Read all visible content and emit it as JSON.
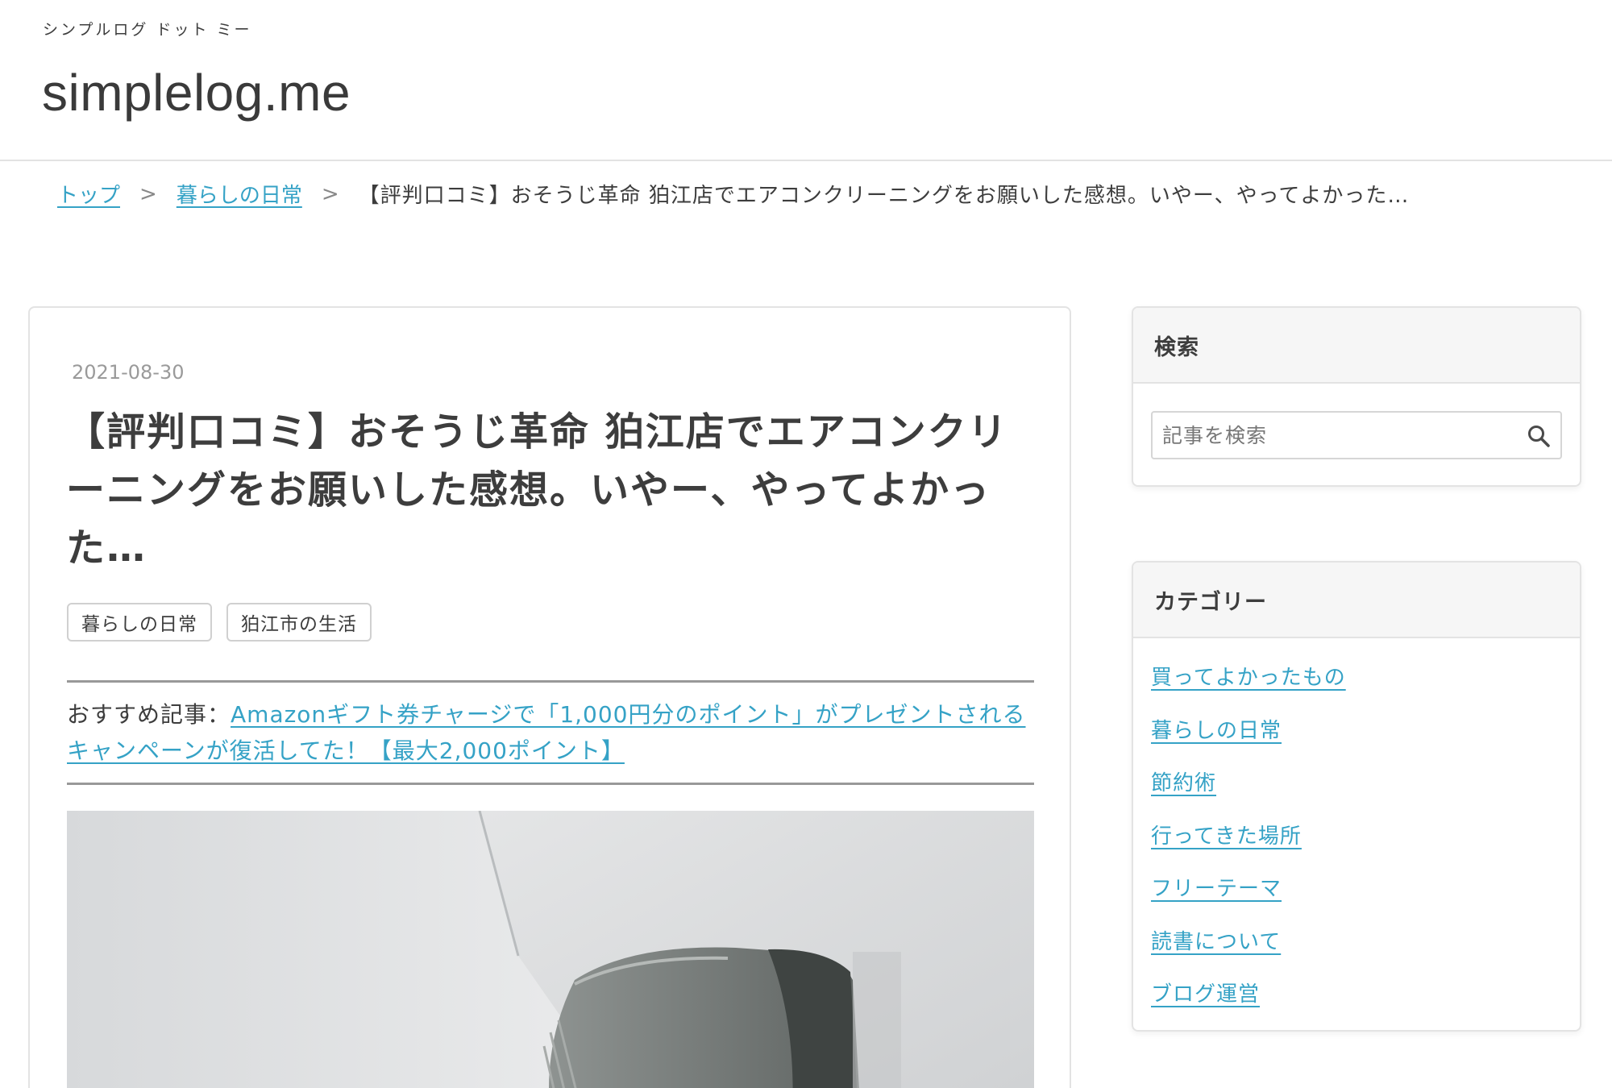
{
  "header": {
    "tagline": "シンプルログ ドット ミー",
    "site_title": "simplelog.me"
  },
  "breadcrumb": {
    "items": [
      {
        "label": "トップ"
      },
      {
        "label": "暮らしの日常"
      }
    ],
    "separator": ">",
    "current": "【評判口コミ】おそうじ革命 狛江店でエアコンクリーニングをお願いした感想。いやー、やってよかった…"
  },
  "article": {
    "date": "2021-08-30",
    "title": "【評判口コミ】おそうじ革命 狛江店でエアコンクリーニングをお願いした感想。いやー、やってよかった…",
    "tags": [
      "暮らしの日常",
      "狛江市の生活"
    ],
    "recommend_label": "おすすめ記事：",
    "recommend_link": "Amazonギフト券チャージで「1,000円分のポイント」がプレゼントされるキャンペーンが復活してた！【最大2,000ポイント】"
  },
  "sidebar": {
    "search": {
      "heading": "検索",
      "placeholder": "記事を検索",
      "icon": "search-icon"
    },
    "categories": {
      "heading": "カテゴリー",
      "items": [
        "買ってよかったもの",
        "暮らしの日常",
        "節約術",
        "行ってきた場所",
        "フリーテーマ",
        "読書について",
        "ブログ運営"
      ]
    }
  },
  "colors": {
    "link": "#35a2c6",
    "text": "#3d3d3d",
    "border": "#e3e3e3",
    "widget_head_bg": "#f6f6f6"
  }
}
